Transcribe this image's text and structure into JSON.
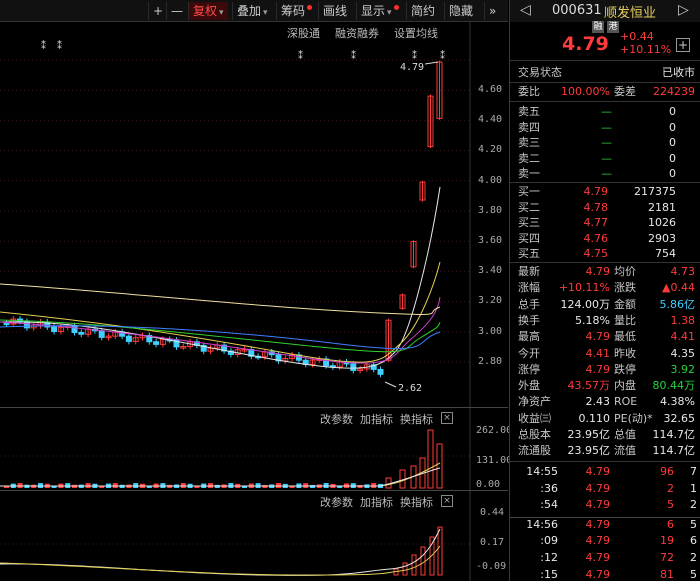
{
  "toolbar": {
    "plus": "+",
    "minus": "—",
    "fuquan": "复权",
    "diejia": "叠加",
    "chouma": "筹码",
    "huaxian": "画线",
    "xianshi": "显示",
    "jianyue": "简约",
    "yincang": "隐藏",
    "collapse": "»"
  },
  "chart": {
    "links": {
      "shengutong": "深股通",
      "rongzi": "融资融券",
      "settings": "设置均线"
    },
    "price_axis": [
      "4.60",
      "4.40",
      "4.20",
      "4.00",
      "3.80",
      "3.60",
      "3.40",
      "3.20",
      "3.00",
      "2.80"
    ],
    "high_label": "4.79",
    "low_label": "2.62",
    "vol_axis": [
      "262.00",
      "131.00",
      "0.00"
    ],
    "ind_axis": [
      "0.44",
      "0.17",
      "-0.09"
    ],
    "vol_panel": {
      "params": "改参数",
      "add": "加指标",
      "switch": "换指标",
      "close": "×"
    },
    "ind_panel": {
      "params": "改参数",
      "add": "加指标",
      "switch": "换指标",
      "close": "×"
    }
  },
  "chart_data": {
    "type": "candlestick",
    "last_close": 4.79,
    "high": 4.79,
    "low": 2.62,
    "price_range": [
      2.7,
      4.75
    ],
    "volume_range": [
      0,
      262
    ],
    "indicator_range": [
      -0.09,
      0.44
    ]
  },
  "quote": {
    "code": "000631",
    "name": "顺发恒业",
    "badge_rong": "融",
    "badge_gang": "港",
    "price": "4.79",
    "change": "+0.44",
    "change_pct": "+10.11%",
    "add": "+",
    "status_label": "交易状态",
    "status_value": "已收市",
    "weibi_label": "委比",
    "weibi_value": "100.00%",
    "weicha_label": "委差",
    "weicha_value": "224239",
    "sells": [
      {
        "label": "卖五",
        "price": "—",
        "vol": "0"
      },
      {
        "label": "卖四",
        "price": "—",
        "vol": "0"
      },
      {
        "label": "卖三",
        "price": "—",
        "vol": "0"
      },
      {
        "label": "卖二",
        "price": "—",
        "vol": "0"
      },
      {
        "label": "卖一",
        "price": "—",
        "vol": "0"
      }
    ],
    "buys": [
      {
        "label": "买一",
        "price": "4.79",
        "vol": "217375"
      },
      {
        "label": "买二",
        "price": "4.78",
        "vol": "2181"
      },
      {
        "label": "买三",
        "price": "4.77",
        "vol": "1026"
      },
      {
        "label": "买四",
        "price": "4.76",
        "vol": "2903"
      },
      {
        "label": "买五",
        "price": "4.75",
        "vol": "754"
      }
    ],
    "stats": [
      {
        "l1": "最新",
        "v1": "4.79",
        "c1": "red",
        "l2": "均价",
        "v2": "4.73",
        "c2": "red"
      },
      {
        "l1": "涨幅",
        "v1": "+10.11%",
        "c1": "red",
        "l2": "涨跌",
        "v2": "▲0.44",
        "c2": "red"
      },
      {
        "l1": "总手",
        "v1": "124.00万",
        "c1": "white",
        "l2": "金额",
        "v2": "5.86亿",
        "c2": "cyan"
      },
      {
        "l1": "换手",
        "v1": "5.18%",
        "c1": "white",
        "l2": "量比",
        "v2": "1.38",
        "c2": "red"
      },
      {
        "l1": "最高",
        "v1": "4.79",
        "c1": "red",
        "l2": "最低",
        "v2": "4.41",
        "c2": "red"
      },
      {
        "l1": "今开",
        "v1": "4.41",
        "c1": "red",
        "l2": "昨收",
        "v2": "4.35",
        "c2": "white"
      },
      {
        "l1": "涨停",
        "v1": "4.79",
        "c1": "red",
        "l2": "跌停",
        "v2": "3.92",
        "c2": "green"
      },
      {
        "l1": "外盘",
        "v1": "43.57万",
        "c1": "red",
        "l2": "内盘",
        "v2": "80.44万",
        "c2": "green"
      },
      {
        "l1": "净资产",
        "v1": "2.43",
        "c1": "white",
        "l2": "ROE",
        "v2": "4.38%",
        "c2": "white"
      },
      {
        "l1": "收益㈢",
        "v1": "0.110",
        "c1": "white",
        "l2": "PE(动)*",
        "v2": "32.65",
        "c2": "white"
      },
      {
        "l1": "总股本",
        "v1": "23.95亿",
        "c1": "white",
        "l2": "总值",
        "v2": "114.7亿",
        "c2": "white"
      },
      {
        "l1": "流通股",
        "v1": "23.95亿",
        "c1": "white",
        "l2": "流值",
        "v2": "114.7亿",
        "c2": "white"
      }
    ],
    "ticks": [
      {
        "time": "14:55",
        "price": "4.79",
        "vol": "96",
        "n": "7"
      },
      {
        "time": ":36",
        "price": "4.79",
        "vol": "2",
        "n": "1"
      },
      {
        "time": ":54",
        "price": "4.79",
        "vol": "5",
        "n": "2"
      },
      {
        "time": "14:56",
        "price": "4.79",
        "vol": "6",
        "n": "5"
      },
      {
        "time": ":09",
        "price": "4.79",
        "vol": "19",
        "n": "6"
      },
      {
        "time": ":12",
        "price": "4.79",
        "vol": "72",
        "n": "2"
      },
      {
        "time": ":15",
        "price": "4.79",
        "vol": "81",
        "n": "5"
      }
    ]
  }
}
